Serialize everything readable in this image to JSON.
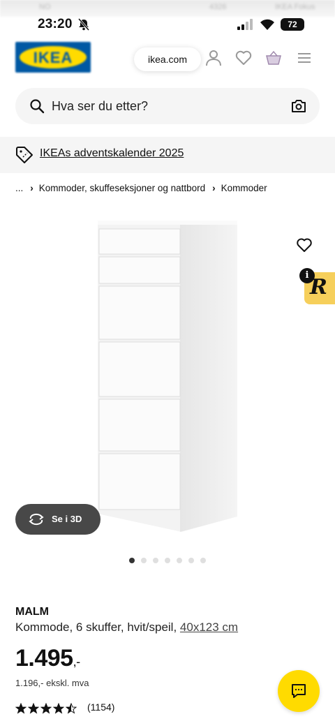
{
  "status_bar": {
    "time": "23:20",
    "battery": "72",
    "blurred_items": [
      "NO",
      "4326",
      "IKEA Fokus"
    ]
  },
  "header": {
    "logo_text": "IKEA",
    "url": "ikea.com",
    "icons": [
      "user-icon",
      "heart-icon",
      "basket-icon",
      "menu-icon"
    ]
  },
  "search": {
    "placeholder": "Hva ser du etter?"
  },
  "promo": {
    "label": "IKEAs adventskalender 2025"
  },
  "breadcrumb": {
    "ellipsis": "...",
    "items": [
      "Kommoder, skuffeseksjoner og nattbord",
      "Kommoder"
    ]
  },
  "gallery": {
    "see_3d_label": "Se i 3D",
    "dot_count": 7,
    "active_dot": 1
  },
  "product": {
    "name": "MALM",
    "description": "Kommode, 6 skuffer, hvit/speil,",
    "dimensions": "40x123 cm",
    "price": "1.495",
    "price_suffix": ",-",
    "price_ex_vat": "1.196,- ekskl. mva",
    "rating": 4.5,
    "review_count": "(1154)"
  },
  "colors": {
    "ikea_blue": "#0058a3",
    "ikea_yellow": "#ffdb00",
    "badge_yellow": "#f6cf5b"
  }
}
